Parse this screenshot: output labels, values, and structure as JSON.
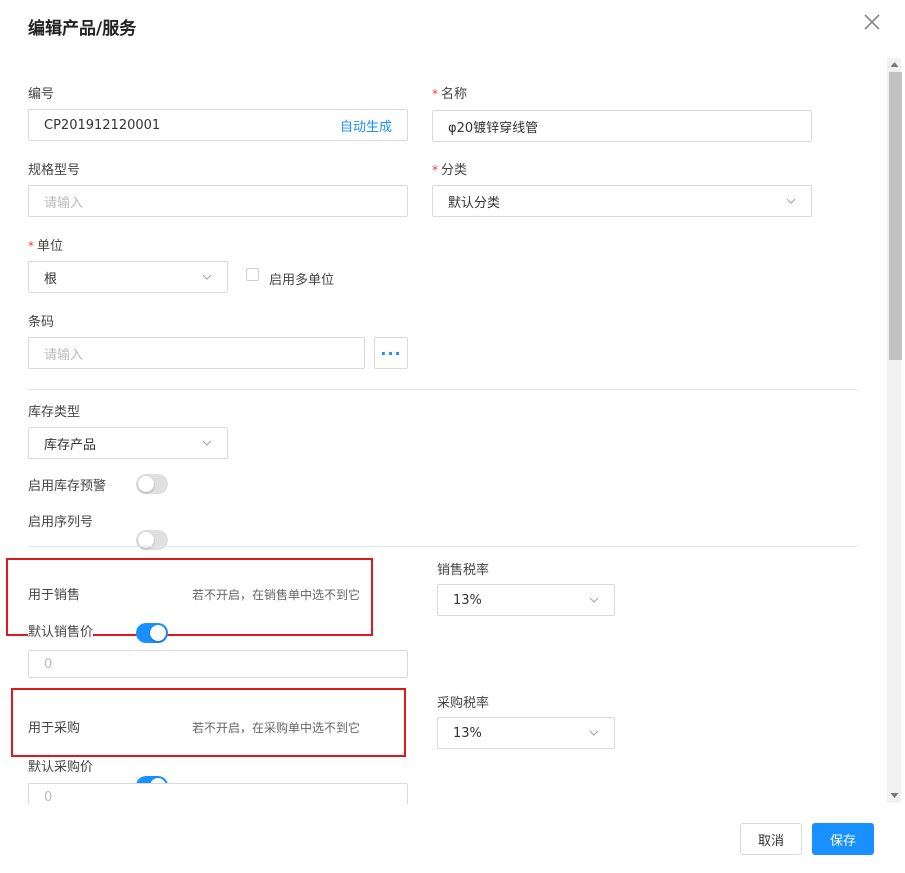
{
  "dialog": {
    "title": "编辑产品/服务",
    "close_icon": "close-icon"
  },
  "form": {
    "code": {
      "label": "编号",
      "value": "CP201912120001",
      "suffix": "自动生成"
    },
    "name": {
      "required_mark": "*",
      "label": "名称",
      "value": "φ20镀锌穿线管"
    },
    "spec": {
      "label": "规格型号",
      "placeholder": "请输入"
    },
    "category": {
      "required_mark": "*",
      "label": "分类",
      "value": "默认分类"
    },
    "unit": {
      "required_mark": "*",
      "label": "单位",
      "value": "根",
      "multi_unit_label": "启用多单位",
      "multi_unit_checked": false
    },
    "barcode": {
      "label": "条码",
      "placeholder": "请输入",
      "more_button": "···"
    },
    "stock_type": {
      "label": "库存类型",
      "value": "库存产品"
    },
    "stock_warning": {
      "label": "启用库存预警",
      "enabled": false
    },
    "serial_number": {
      "label": "启用序列号",
      "enabled": false
    },
    "for_sale": {
      "label": "用于销售",
      "enabled": true,
      "hint": "若不开启，在销售单中选不到它"
    },
    "sale_tax": {
      "label": "销售税率",
      "value": "13%"
    },
    "default_sale_price": {
      "label": "默认销售价",
      "placeholder": "0"
    },
    "for_purchase": {
      "label": "用于采购",
      "enabled": true,
      "hint": "若不开启，在采购单中选不到它"
    },
    "purchase_tax": {
      "label": "采购税率",
      "value": "13%"
    },
    "default_purchase_price": {
      "label": "默认采购价",
      "placeholder": "0"
    }
  },
  "footer": {
    "cancel": "取消",
    "save": "保存"
  },
  "colors": {
    "accent": "#1890ff",
    "highlight_box": "#e0181e",
    "required": "#f04134"
  }
}
